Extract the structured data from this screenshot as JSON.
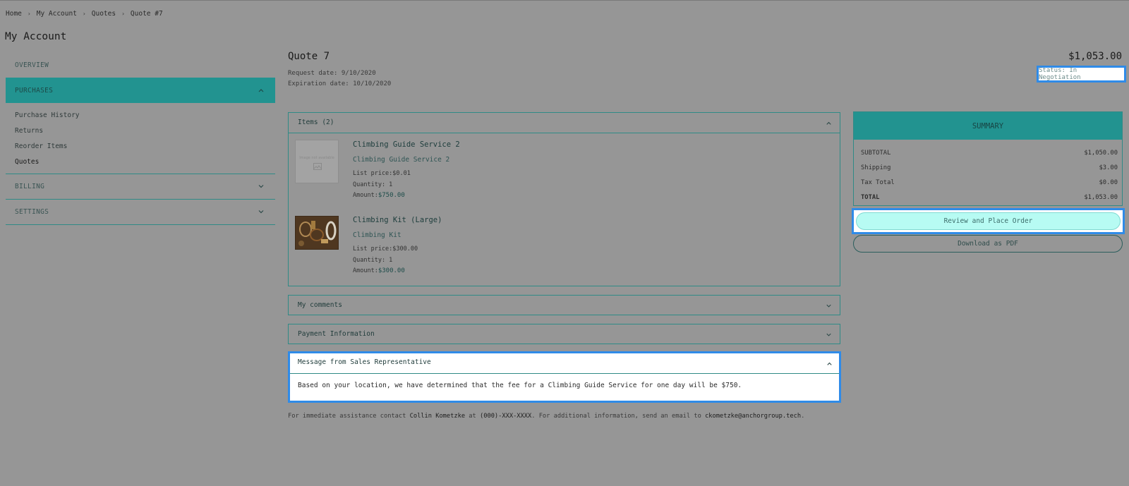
{
  "breadcrumb": [
    "Home",
    "My Account",
    "Quotes",
    "Quote #7"
  ],
  "page_title": "My Account",
  "sidebar": {
    "overview": "OVERVIEW",
    "purchases": "PURCHASES",
    "purchases_items": [
      "Purchase History",
      "Returns",
      "Reorder Items",
      "Quotes"
    ],
    "billing": "BILLING",
    "settings": "SETTINGS"
  },
  "quote": {
    "title": "Quote 7",
    "request_date": "Request date: 9/10/2020",
    "expiration_date": "Expiration date: 10/10/2020",
    "total": "$1,053.00",
    "status": "Status: In Negotiation"
  },
  "items_panel": {
    "title": "Items (2)",
    "placeholder_text": "Image not available",
    "items": [
      {
        "name": "Climbing Guide Service 2",
        "subtitle": "Climbing Guide Service 2",
        "list_price_label": "List price:",
        "list_price": "$0.01",
        "quantity": "Quantity: 1",
        "amount_label": "Amount:",
        "amount": "$750.00"
      },
      {
        "name": "Climbing Kit (Large)",
        "subtitle": "Climbing Kit",
        "list_price_label": "List price:",
        "list_price": "$300.00",
        "quantity": "Quantity: 1",
        "amount_label": "Amount:",
        "amount": "$300.00"
      }
    ]
  },
  "comments_panel": {
    "title": "My comments"
  },
  "payment_panel": {
    "title": "Payment Information"
  },
  "message_panel": {
    "title": "Message from Sales Representative",
    "body": "Based on your location, we have determined that the fee for a Climbing Guide Service for one day will be $750."
  },
  "footer": {
    "prefix": "For immediate assistance contact ",
    "contact_name": "Collin Kometzke",
    "at": " at ",
    "phone": "(000)-XXX-XXXX",
    "middle": ". For additional information, send an email to ",
    "email": "ckometzke@anchorgroup.tech",
    "suffix": "."
  },
  "summary": {
    "title": "SUMMARY",
    "rows": [
      {
        "label": "SUBTOTAL",
        "value": "$1,050.00"
      },
      {
        "label": "Shipping",
        "value": "$3.00"
      },
      {
        "label": "Tax Total",
        "value": "$0.00"
      },
      {
        "label": "TOTAL",
        "value": "$1,053.00"
      }
    ],
    "primary_button": "Review and Place Order",
    "secondary_button": "Download as PDF"
  },
  "colors": {
    "background": "#969696",
    "accent_teal": "#229390",
    "highlight_blue": "#2f8be8",
    "primary_button": "#b7fbf3"
  },
  "icons": [
    "chevron-right-icon",
    "chevron-up-icon",
    "chevron-down-icon",
    "image-placeholder-icon"
  ]
}
